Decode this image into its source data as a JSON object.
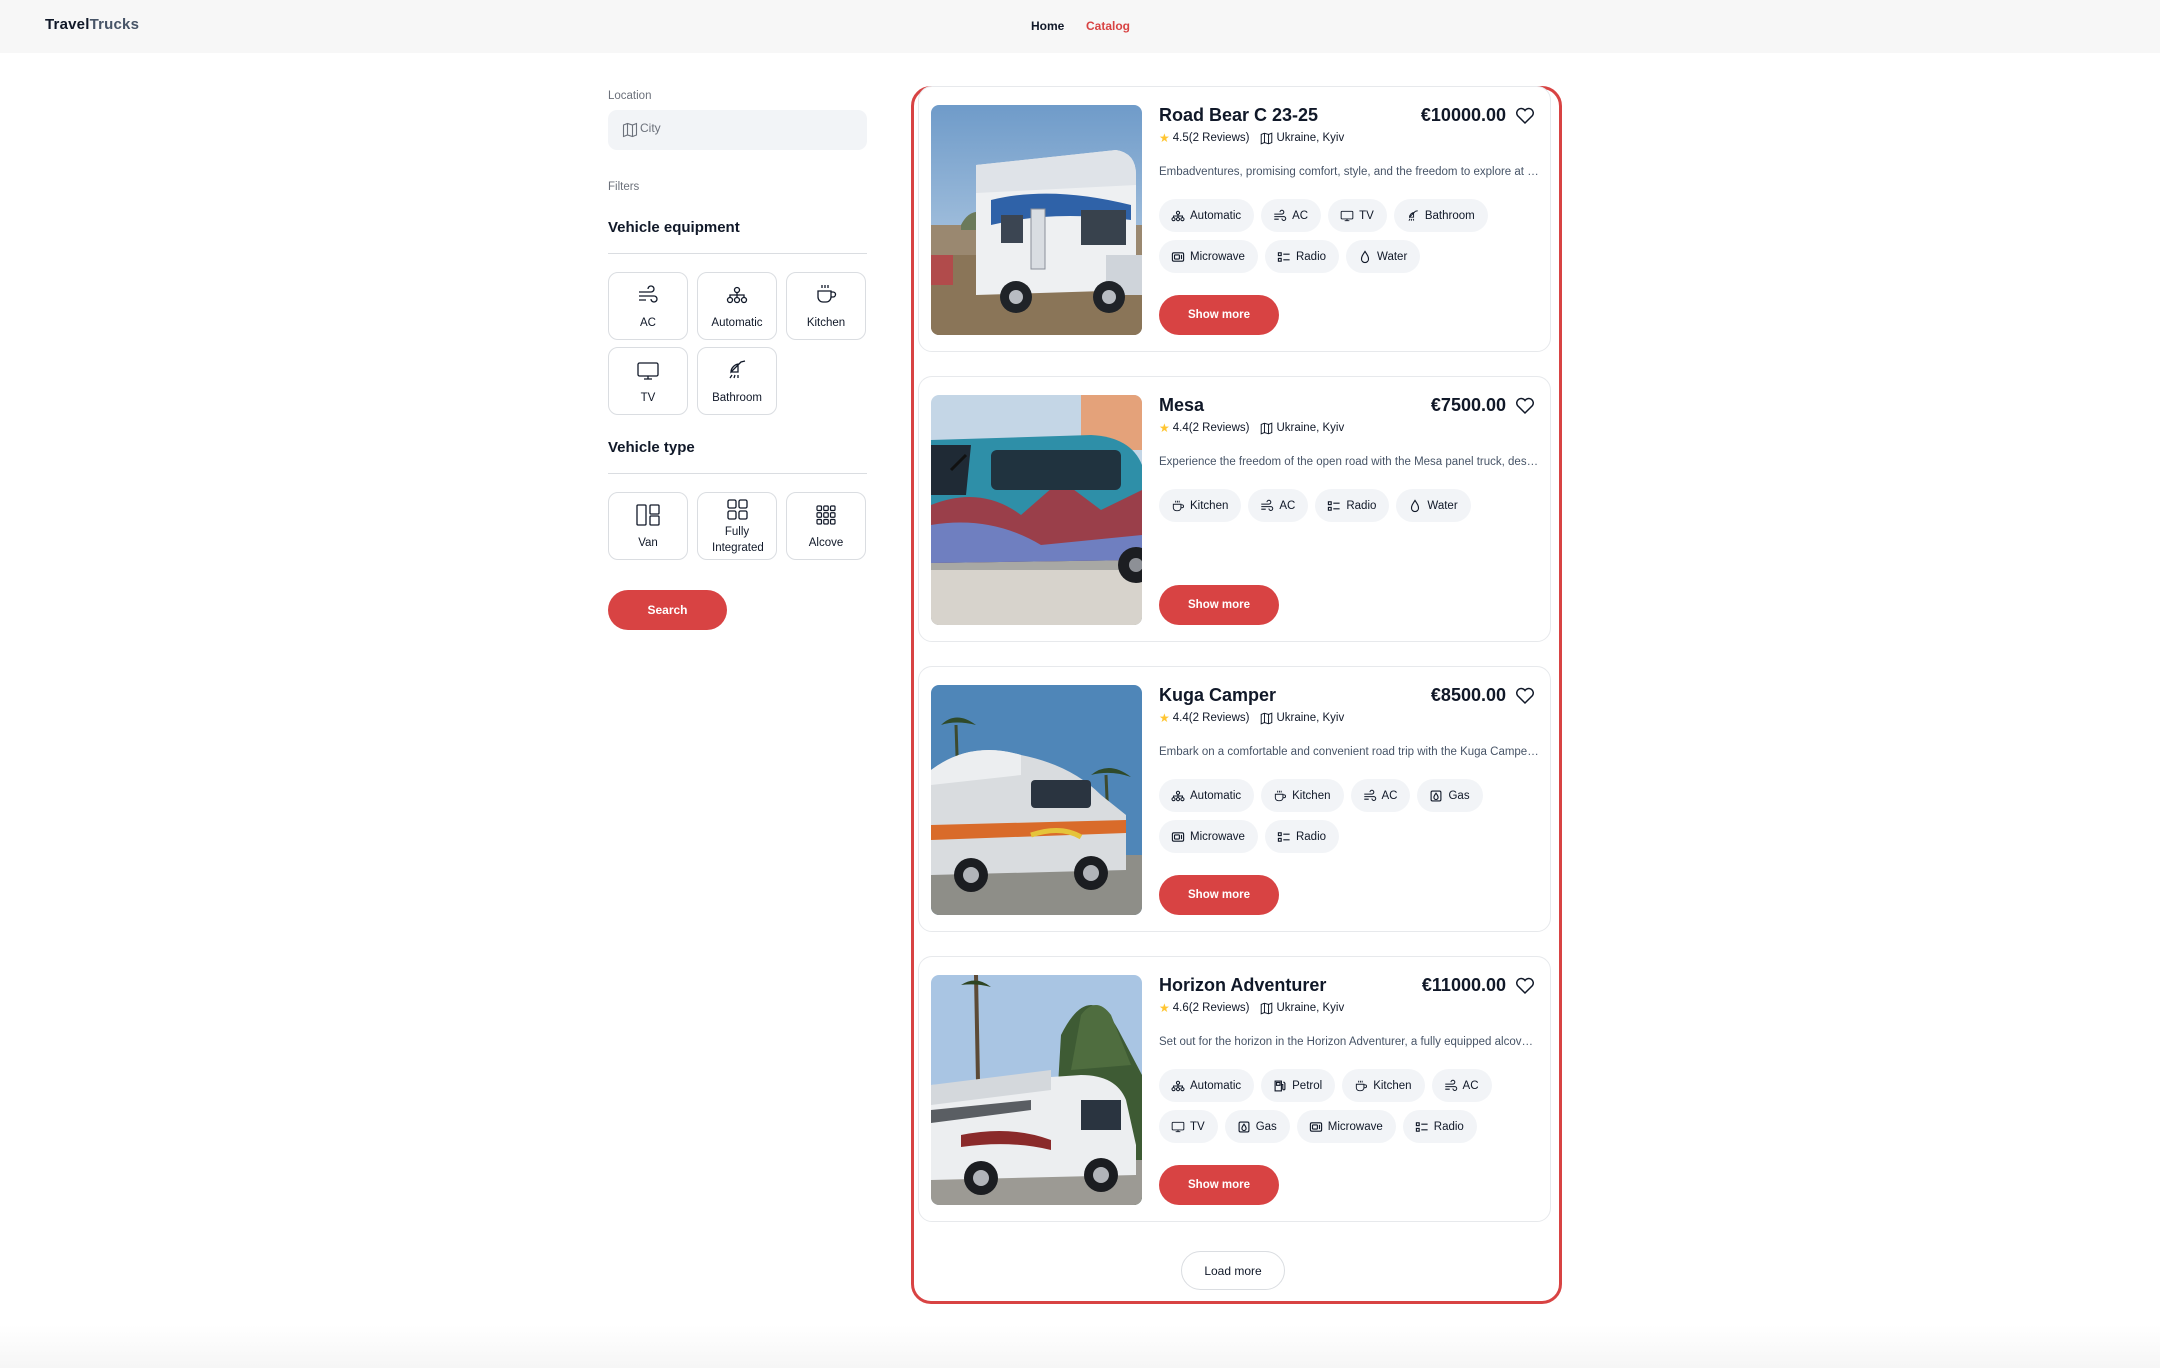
{
  "header": {
    "logo_bold": "Travel",
    "logo_rest": "Trucks",
    "nav": {
      "home": "Home",
      "catalog": "Catalog"
    }
  },
  "sidebar": {
    "location_label": "Location",
    "location_placeholder": "City",
    "filters_label": "Filters",
    "equipment_title": "Vehicle equipment",
    "equipment": [
      {
        "label": "AC",
        "icon": "wind-icon"
      },
      {
        "label": "Automatic",
        "icon": "diagram-icon"
      },
      {
        "label": "Kitchen",
        "icon": "cup-icon"
      },
      {
        "label": "TV",
        "icon": "tv-icon"
      },
      {
        "label": "Bathroom",
        "icon": "shower-icon"
      }
    ],
    "type_title": "Vehicle type",
    "types": [
      {
        "label": "Van",
        "icon": "grid-2-icon"
      },
      {
        "label": "Fully Integrated",
        "icon": "grid-4-icon"
      },
      {
        "label": "Alcove",
        "icon": "grid-9-icon"
      }
    ],
    "search_label": "Search"
  },
  "campers": [
    {
      "name": "Road Bear C 23-25",
      "price": "€10000.00",
      "rating": "4.5(2 Reviews)",
      "location": "Ukraine, Kyiv",
      "description": "Embadventures, promising comfort, style, and the freedom to explore at your own pace.",
      "features": [
        "Automatic",
        "AC",
        "TV",
        "Bathroom",
        "Microwave",
        "Radio",
        "Water"
      ],
      "show_more": "Show more"
    },
    {
      "name": "Mesa",
      "price": "€7500.00",
      "rating": "4.4(2 Reviews)",
      "location": "Ukraine, Kyiv",
      "description": "Experience the freedom of the open road with the Mesa panel truck, designed for adventurers.",
      "features": [
        "Kitchen",
        "AC",
        "Radio",
        "Water"
      ],
      "show_more": "Show more"
    },
    {
      "name": "Kuga Camper",
      "price": "€8500.00",
      "rating": "4.4(2 Reviews)",
      "location": "Ukraine, Kyiv",
      "description": "Embark on a comfortable and convenient road trip with the Kuga Camper van.",
      "features": [
        "Automatic",
        "Kitchen",
        "AC",
        "Gas",
        "Microwave",
        "Radio"
      ],
      "show_more": "Show more"
    },
    {
      "name": "Horizon Adventurer",
      "price": "€11000.00",
      "rating": "4.6(2 Reviews)",
      "location": "Ukraine, Kyiv",
      "description": "Set out for the horizon in the Horizon Adventurer, a fully equipped alcove camper.",
      "features": [
        "Automatic",
        "Petrol",
        "Kitchen",
        "AC",
        "TV",
        "Gas",
        "Microwave",
        "Radio"
      ],
      "show_more": "Show more"
    }
  ],
  "load_more": "Load more",
  "colors": {
    "accent": "#d84343",
    "chip_bg": "#f2f4f7",
    "star": "#ffc531"
  }
}
